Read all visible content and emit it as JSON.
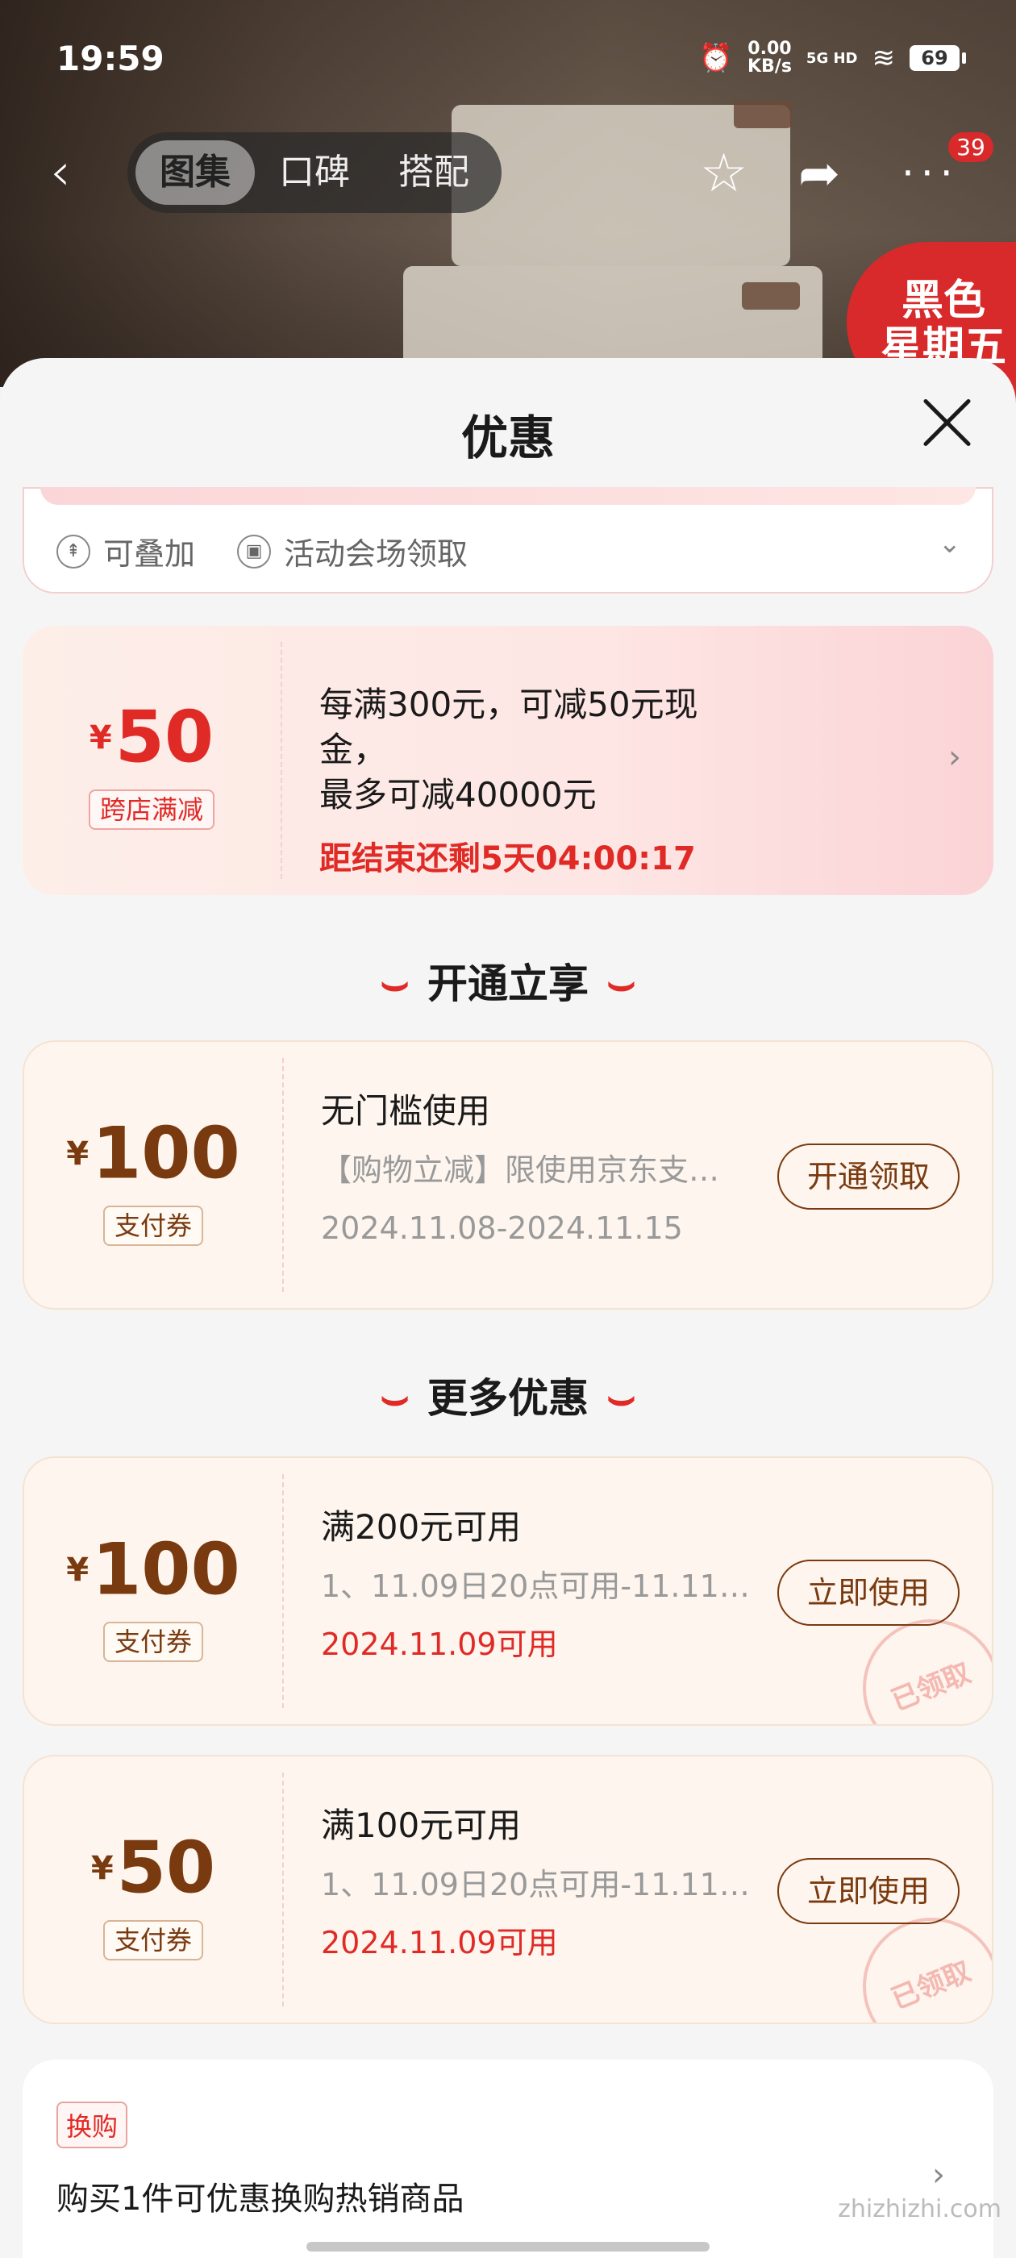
{
  "status_bar": {
    "time": "19:59",
    "net_speed": "0.00",
    "net_unit": "KB/s",
    "signal": "5G HD",
    "battery": "69"
  },
  "nav": {
    "tabs": [
      "图集",
      "口碑",
      "搭配"
    ],
    "active_tab": 0,
    "more_count": "39",
    "promo_badge_line1": "黑色",
    "promo_badge_line2": "星期五"
  },
  "sheet": {
    "title": "优惠",
    "partial_card": {
      "tag1": "可叠加",
      "tag2": "活动会场领取"
    },
    "cross_store": {
      "currency": "¥",
      "amount": "50",
      "tag": "跨店满减",
      "line1": "每满300元，可减50元现金，",
      "line2": "最多可减40000元",
      "countdown": "距结束还剩5天04:00:17"
    },
    "section1_title": "开通立享",
    "coupon_open": {
      "currency": "¥",
      "amount": "100",
      "tag": "支付券",
      "title": "无门槛使用",
      "desc": "【购物立减】限使用京东支…",
      "date": "2024.11.08-2024.11.15",
      "button": "开通领取"
    },
    "section2_title": "更多优惠",
    "coupons": [
      {
        "currency": "¥",
        "amount": "100",
        "tag": "支付券",
        "title": "满200元可用",
        "desc": "1、11.09日20点可用-11.11…",
        "date": "2024.11.09可用",
        "button": "立即使用",
        "stamp": "已领取"
      },
      {
        "currency": "¥",
        "amount": "50",
        "tag": "支付券",
        "title": "满100元可用",
        "desc": "1、11.09日20点可用-11.11…",
        "date": "2024.11.09可用",
        "button": "立即使用",
        "stamp": "已领取"
      }
    ],
    "swap": {
      "tag": "换购",
      "text": "购买1件可优惠换购热销商品"
    }
  },
  "watermark": "zhizhizhi.com",
  "colors": {
    "accent_red": "#e02a26",
    "coupon_brown": "#7a3a10"
  }
}
